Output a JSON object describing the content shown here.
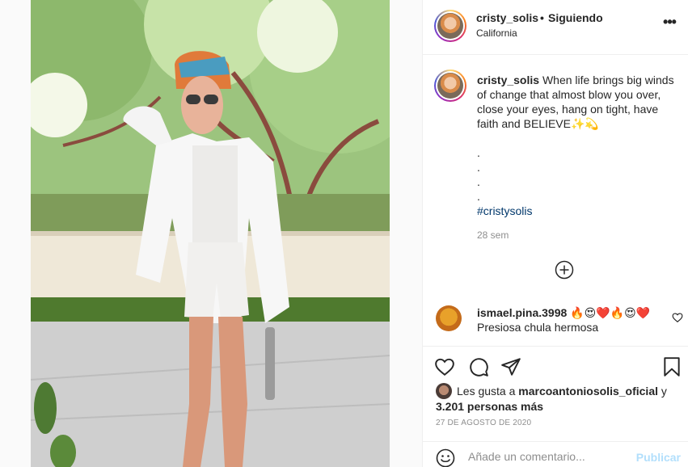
{
  "header": {
    "username": "cristy_solis",
    "separator": "•",
    "follow_status": "Siguiendo",
    "location": "California",
    "more_icon": "more-horizontal-icon",
    "more_label": "•••"
  },
  "caption": {
    "username": "cristy_solis",
    "text": "When life brings big winds of change that almost blow you over, close your eyes, hang on tight, have faith and BELIEVE✨💫",
    "dots": [
      ".",
      ".",
      ".",
      "."
    ],
    "hashtag": "#cristysolis",
    "time_ago": "28 sem"
  },
  "load_more_icon": "plus-circle-icon",
  "comments": [
    {
      "username": "ismael.pina.3998",
      "emojis": "🔥😍❤️🔥😍❤️",
      "text": "Presiosa chula hermosa"
    }
  ],
  "actions": {
    "like_icon": "heart-icon",
    "comment_icon": "comment-icon",
    "share_icon": "send-icon",
    "save_icon": "bookmark-icon"
  },
  "likes": {
    "prefix": "Les gusta a",
    "first_user": "marcoantoniosolis_oficial",
    "conjunction": "y",
    "others": "3.201 personas más"
  },
  "date": "27 DE AGOSTO DE 2020",
  "comment_box": {
    "placeholder": "Añade un comentario...",
    "publish_label": "Publicar",
    "emoji_icon": "smiley-icon"
  },
  "colors": {
    "link": "#00376b",
    "muted": "#8e8e8e",
    "publish_disabled": "#b2dffc",
    "text": "#262626"
  }
}
